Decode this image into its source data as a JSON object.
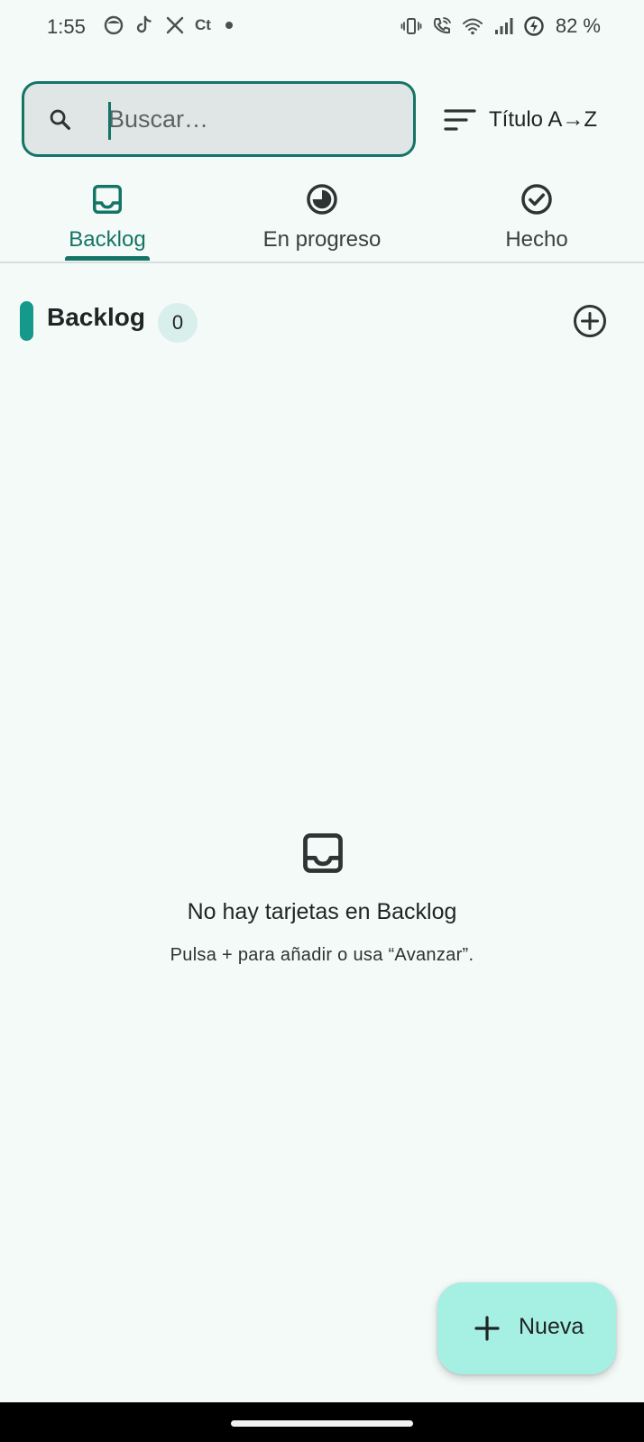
{
  "status_bar": {
    "time": "1:55",
    "notification_icons": [
      "face-icon",
      "tiktok-icon",
      "x-icon",
      "ct-icon"
    ],
    "ct_text": "Ct",
    "system_icons": [
      "vibrate-icon",
      "wifi-call-icon",
      "wifi-icon",
      "signal-icon",
      "battery-charging-icon"
    ],
    "battery": "82 %"
  },
  "search": {
    "placeholder": "Buscar…",
    "value": ""
  },
  "sort": {
    "label": "Título A→Z",
    "icon": "sort-icon"
  },
  "tabs": [
    {
      "label": "Backlog",
      "icon": "inbox-icon",
      "active": true
    },
    {
      "label": "En progreso",
      "icon": "progress-icon",
      "active": false
    },
    {
      "label": "Hecho",
      "icon": "check-circle-icon",
      "active": false
    }
  ],
  "column": {
    "title": "Backlog",
    "count": "0",
    "accent_color": "#15998a"
  },
  "empty_state": {
    "icon": "inbox-icon",
    "title": "No hay tarjetas en Backlog",
    "subtitle": "Pulsa + para añadir o usa “Avanzar”."
  },
  "fab": {
    "label": "Nueva",
    "icon": "plus-icon"
  },
  "colors": {
    "primary": "#147466",
    "background": "#f4faf8",
    "search_fill": "#dfe6e5",
    "fab": "#a6efe3",
    "count_badge": "#d9efec"
  }
}
